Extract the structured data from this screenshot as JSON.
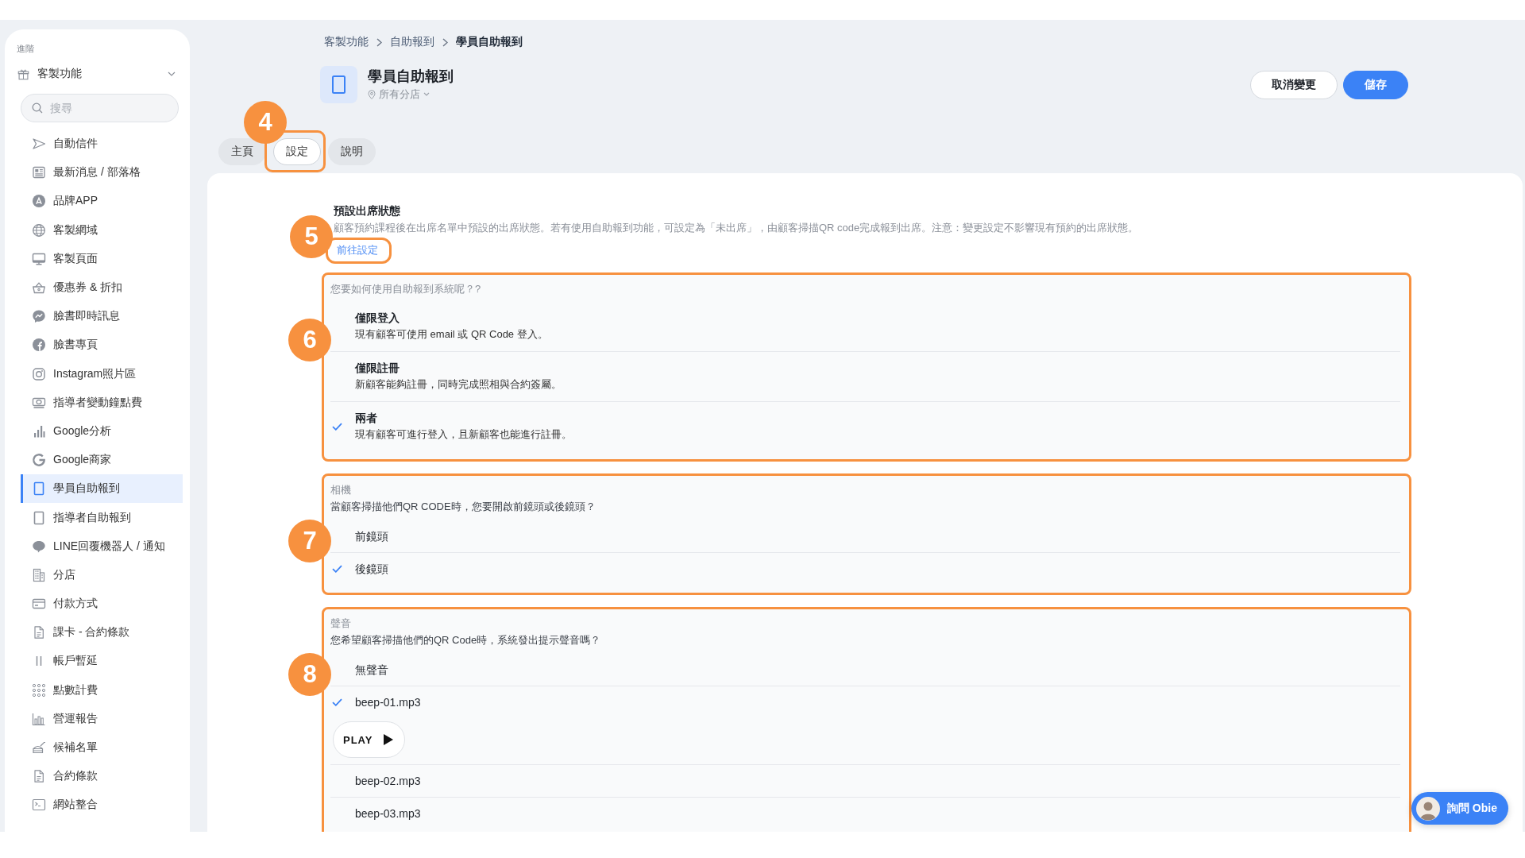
{
  "sidebar": {
    "section_label": "進階",
    "group": {
      "label": "客製功能",
      "expanded": true
    },
    "search": {
      "placeholder": "搜尋"
    },
    "items": [
      {
        "label": "自動信件",
        "selected": false
      },
      {
        "label": "最新消息 / 部落格",
        "selected": false
      },
      {
        "label": "品牌APP",
        "selected": false
      },
      {
        "label": "客製網域",
        "selected": false
      },
      {
        "label": "客製頁面",
        "selected": false
      },
      {
        "label": "優惠券 & 折扣",
        "selected": false
      },
      {
        "label": "臉書即時訊息",
        "selected": false
      },
      {
        "label": "臉書專頁",
        "selected": false
      },
      {
        "label": "Instagram照片區",
        "selected": false
      },
      {
        "label": "指導者變動鐘點費",
        "selected": false
      },
      {
        "label": "Google分析",
        "selected": false
      },
      {
        "label": "Google商家",
        "selected": false
      },
      {
        "label": "學員自助報到",
        "selected": true
      },
      {
        "label": "指導者自助報到",
        "selected": false
      },
      {
        "label": "LINE回覆機器人 / 通知",
        "selected": false
      },
      {
        "label": "分店",
        "selected": false
      },
      {
        "label": "付款方式",
        "selected": false
      },
      {
        "label": "課卡 - 合約條款",
        "selected": false
      },
      {
        "label": "帳戶暫延",
        "selected": false
      },
      {
        "label": "點數計費",
        "selected": false
      },
      {
        "label": "營運報告",
        "selected": false
      },
      {
        "label": "候補名單",
        "selected": false
      },
      {
        "label": "合約條款",
        "selected": false
      },
      {
        "label": "網站整合",
        "selected": false
      }
    ]
  },
  "breadcrumb": [
    {
      "label": "客製功能",
      "current": false
    },
    {
      "label": "自助報到",
      "current": false
    },
    {
      "label": "學員自助報到",
      "current": true
    }
  ],
  "header": {
    "title": "學員自助報到",
    "location": "所有分店",
    "buttons": [
      {
        "label": "取消變更",
        "kind": "secondary"
      },
      {
        "label": "儲存",
        "kind": "primary"
      }
    ]
  },
  "tabs": [
    {
      "label": "主頁",
      "selected": false
    },
    {
      "label": "設定",
      "selected": true,
      "callout": "4"
    },
    {
      "label": "說明",
      "selected": false
    }
  ],
  "default_status": {
    "title": "預設出席狀態",
    "description": "顧客預約課程後在出席名單中預設的出席狀態。若有使用自助報到功能，可設定為「未出席」，由顧客掃描QR code完成報到出席。注意：變更設定不影響現有預約的出席狀態。",
    "link": "前往設定",
    "callout": "5"
  },
  "sections": [
    {
      "callout": "6",
      "label": "您要如何使用自助報到系統呢？?",
      "options": [
        {
          "title": "僅限登入",
          "description": "現有顧客可使用 email 或 QR Code 登入。",
          "selected": false
        },
        {
          "title": "僅限註冊",
          "description": "新顧客能夠註冊，同時完成照相與合約簽屬。",
          "selected": false
        },
        {
          "title": "兩者",
          "description": "現有顧客可進行登入，且新顧客也能進行註冊。",
          "selected": true
        }
      ]
    },
    {
      "callout": "7",
      "label": "相機",
      "question": "當顧客掃描他們QR CODE時，您要開啟前鏡頭或後鏡頭？",
      "options": [
        {
          "title": "前鏡頭",
          "selected": false
        },
        {
          "title": "後鏡頭",
          "selected": true
        }
      ]
    },
    {
      "callout": "8",
      "label": "聲音",
      "question": "您希望顧客掃描他們的QR Code時，系統發出提示聲音嗎？",
      "options": [
        {
          "title": "無聲音",
          "selected": false
        },
        {
          "title": "beep-01.mp3",
          "selected": true,
          "action": "PLAY"
        },
        {
          "title": "beep-02.mp3",
          "selected": false
        },
        {
          "title": "beep-03.mp3",
          "selected": false
        }
      ]
    }
  ],
  "chat_button": {
    "label": "詢問 Obie"
  }
}
